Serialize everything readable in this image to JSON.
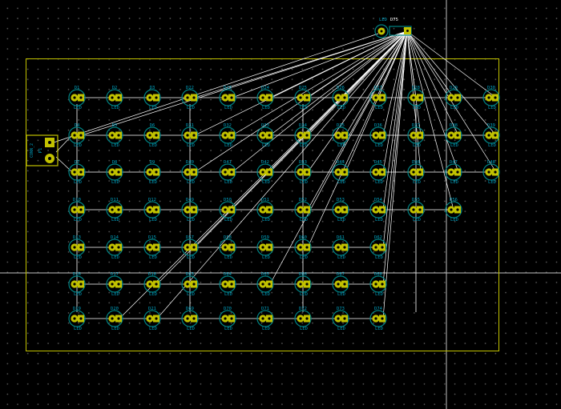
{
  "board": {
    "name": "PCB layout view",
    "outline_color": "#c2c200",
    "ratsnest_color": "#ffffff",
    "pad_color": "#c2c200",
    "silk_color": "#008484",
    "ref_text_color": "#00a0c0"
  },
  "leds": {
    "value_label": "LED",
    "rows": [
      [
        "D1",
        "D2",
        "D3",
        "D22",
        "D23",
        "D24",
        "D25",
        "D26",
        "D27",
        "D28",
        "D29",
        "D30"
      ],
      [
        "D4",
        "D5",
        "D6",
        "D31",
        "D32",
        "D33",
        "D34",
        "D35",
        "D36",
        "D37",
        "D38",
        "D39"
      ],
      [
        "D7",
        "D8",
        "D9",
        "D40",
        "D41",
        "D42",
        "D43",
        "D44",
        "D45",
        "D46",
        "D47",
        "D48"
      ],
      [
        "D10",
        "D11",
        "D12",
        "D49",
        "D50",
        "D51",
        "D52",
        "D53",
        "D54",
        "D55",
        "D56"
      ],
      [
        "D13",
        "D14",
        "D15",
        "D57",
        "D58",
        "D59",
        "D60",
        "D61",
        "D62"
      ],
      [
        "D16",
        "D17",
        "D18",
        "D63",
        "D64",
        "D65",
        "D66",
        "D67",
        "D68"
      ],
      [
        "D19",
        "D20",
        "D21",
        "D69",
        "D70",
        "D71",
        "D72",
        "D73",
        "D74"
      ]
    ]
  },
  "connector": {
    "ref": "P1",
    "value": "CONN_2"
  },
  "top_led": {
    "ref": "D75",
    "value": "LED"
  }
}
